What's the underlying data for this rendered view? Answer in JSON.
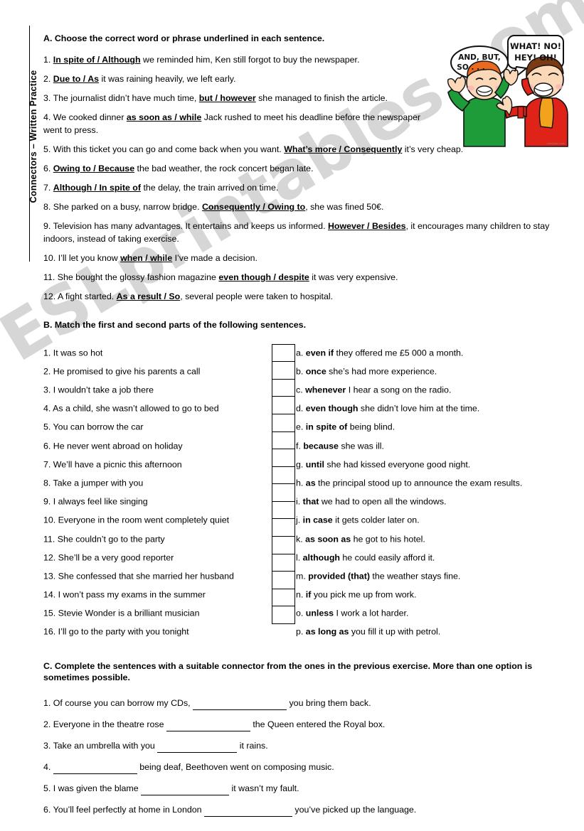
{
  "document": {
    "side_title": "Connectors – Written Practice"
  },
  "clipart": {
    "bubble_left_line1": "AND, BUT,",
    "bubble_left_line2": "SO . . .",
    "bubble_right_line1": "WHAT! NO!",
    "bubble_right_line2": "HEY! OH!",
    "credit": "oneclipart.com",
    "colors": {
      "shirt_left": "#1f9c3a",
      "shirt_right": "#e02318",
      "hair_left": "#e86a1e",
      "hair_right": "#7a3b14",
      "skin": "#fbd9b8",
      "bubble_fill": "#ffffff",
      "outline": "#111111"
    }
  },
  "section_a": {
    "heading": "A. Choose the correct word or phrase underlined in each sentence.",
    "items": [
      {
        "number": "1.",
        "pre": "",
        "choice": "In spite of / Although",
        "post": " we reminded him, Ken still forgot to buy the newspaper.",
        "narrow": true
      },
      {
        "number": "2.",
        "pre": "",
        "choice": "Due to / As",
        "post": " it was raining heavily, we left early.",
        "narrow": true
      },
      {
        "number": "3.",
        "pre": "The journalist didn’t have much time, ",
        "choice": "but / however",
        "post": " she managed to finish the article.",
        "narrow": true
      },
      {
        "number": "4.",
        "pre": "We cooked dinner ",
        "choice": "as soon as / while",
        "post": " Jack rushed to meet his deadline before the newspaper went to press.",
        "narrow": true
      },
      {
        "number": "5.",
        "pre": "With this ticket you can go and come back when you want. ",
        "choice": "What’s more / Consequently",
        "post": " it’s very cheap.",
        "narrow": false
      },
      {
        "number": "6.",
        "pre": " ",
        "choice": "Owing to / Because",
        "post": " the bad weather, the rock concert began late.",
        "narrow": false
      },
      {
        "number": "7.",
        "pre": "",
        "choice": "Although / In spite of",
        "post": " the delay, the train arrived on time.",
        "narrow": false
      },
      {
        "number": "8.",
        "pre": "She parked on a busy, narrow bridge. ",
        "choice": "Consequently / Owing to",
        "post": ", she was fined 50€.",
        "narrow": false
      },
      {
        "number": "9.",
        "pre": "Television has many advantages. It entertains and keeps us informed. ",
        "choice": "However / Besides",
        "post": ", it encourages many children to stay indoors, instead of taking exercise.",
        "narrow": false
      },
      {
        "number": "10.",
        "pre": "I’ll let you know ",
        "choice": "when / while",
        "post": " I’ve made a decision.",
        "narrow": false
      },
      {
        "number": "11.",
        "pre": "She bought the glossy fashion magazine ",
        "choice": "even though / despite",
        "post": " it was very expensive.",
        "narrow": false
      },
      {
        "number": "12.",
        "pre": "A fight started. ",
        "choice": "As a result / So",
        "post": ", several people were taken to hospital.",
        "narrow": false
      }
    ]
  },
  "section_b": {
    "heading": "B. Match the first and second parts of the following sentences.",
    "left_column": [
      "1. It was so hot",
      "2. He promised to give his parents a call",
      "3. I wouldn’t take a job there",
      "4. As a child, she wasn’t allowed to go to bed",
      "5. You can borrow the car",
      "6. He never went abroad on holiday",
      "7. We’ll have a picnic this afternoon",
      "8. Take a jumper with you",
      "9. I always feel like singing",
      "10. Everyone in the room went completely quiet",
      "11. She couldn’t go to the party",
      "12. She’ll be a very good reporter",
      "13. She confessed that she married her husband",
      "14. I won’t pass my exams in the summer",
      "15. Stevie Wonder is a brilliant musician",
      "16. I’ll go to the party with you tonight"
    ],
    "right_column": [
      {
        "letter": "a.",
        "connector": "even if",
        "rest": " they offered me £5 000 a month."
      },
      {
        "letter": "b.",
        "connector": "once",
        "rest": " she’s had more experience."
      },
      {
        "letter": "c.",
        "connector": "whenever",
        "rest": " I hear a song on the radio."
      },
      {
        "letter": "d.",
        "connector": "even though",
        "rest": " she didn’t love him at the time."
      },
      {
        "letter": "e.",
        "connector": "in spite of",
        "rest": " being blind."
      },
      {
        "letter": "f.",
        "connector": "because",
        "rest": " she was ill."
      },
      {
        "letter": "g.",
        "connector": "until",
        "rest": " she had kissed everyone good night."
      },
      {
        "letter": "h.",
        "connector": "as",
        "rest": " the principal stood up to announce the exam results."
      },
      {
        "letter": "i.",
        "connector": "that",
        "rest": " we had to open all the windows."
      },
      {
        "letter": "j.",
        "connector": "in case",
        "rest": " it gets colder later on."
      },
      {
        "letter": "k.",
        "connector": "as soon as",
        "rest": " he got to his hotel."
      },
      {
        "letter": "l.",
        "connector": "although",
        "rest": " he could easily afford it."
      },
      {
        "letter": "m.",
        "connector": "provided (that)",
        "rest": " the weather stays fine."
      },
      {
        "letter": "n.",
        "connector": "if",
        "rest": " you pick me up from work."
      },
      {
        "letter": "o.",
        "connector": "unless",
        "rest": " I work a lot harder."
      },
      {
        "letter": "p.",
        "connector": "as long as",
        "rest": " you fill it up with petrol."
      }
    ],
    "answer_boxes": [
      "",
      "",
      "",
      "",
      "",
      "",
      "",
      "",
      "",
      "",
      "",
      "",
      "",
      "",
      "",
      ""
    ]
  },
  "section_c": {
    "heading": "C. Complete the sentences with a suitable connector from the ones in the previous exercise. More than one option is sometimes possible.",
    "items": [
      {
        "number": "1.",
        "pre": "Of course you can borrow my CDs, ",
        "post": " you bring them back."
      },
      {
        "number": "2.",
        "pre": "Everyone in the theatre rose ",
        "post": " the Queen entered the Royal box."
      },
      {
        "number": "3.",
        "pre": "Take an umbrella with you ",
        "post": " it rains."
      },
      {
        "number": "4.",
        "pre": "",
        "post": " being deaf, Beethoven went on composing music."
      },
      {
        "number": "5.",
        "pre": "I was given the blame ",
        "post": " it wasn’t my fault."
      },
      {
        "number": "6.",
        "pre": "You’ll feel perfectly at home in London ",
        "post": " you’ve picked up the language."
      }
    ]
  },
  "watermark": {
    "text": "ESLprintables.com"
  }
}
